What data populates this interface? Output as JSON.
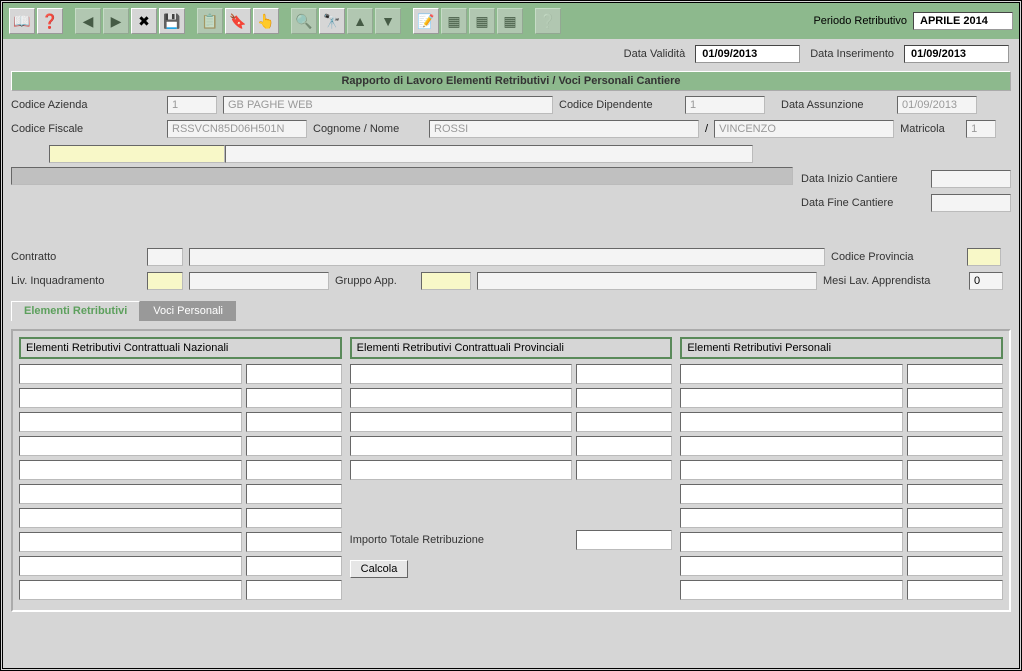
{
  "toolbar": {
    "period_label": "Periodo Retributivo",
    "period_value": "APRILE 2014",
    "icons": [
      "help",
      "hint",
      "back",
      "fwd",
      "close",
      "save",
      "log",
      "tag",
      "hand",
      "search",
      "binoc",
      "up",
      "down",
      "note",
      "grid1",
      "grid2",
      "grid3",
      "about"
    ]
  },
  "topdates": {
    "validita_label": "Data Validità",
    "validita_value": "01/09/2013",
    "inserimento_label": "Data Inserimento",
    "inserimento_value": "01/09/2013"
  },
  "section_title": "Rapporto di Lavoro Elementi Retributivi / Voci Personali Cantiere",
  "head": {
    "codice_azienda_label": "Codice Azienda",
    "codice_azienda_code": "1",
    "codice_azienda_name": "GB PAGHE WEB",
    "codice_dipendente_label": "Codice Dipendente",
    "codice_dipendente_value": "1",
    "data_assunzione_label": "Data Assunzione",
    "data_assunzione_value": "01/09/2013",
    "codice_fiscale_label": "Codice Fiscale",
    "codice_fiscale_value": "RSSVCN85D06H501N",
    "cognome_nome_label": "Cognome / Nome",
    "cognome_value": "ROSSI",
    "nome_value": "VINCENZO",
    "matricola_label": "Matricola",
    "matricola_value": "1"
  },
  "cantiere": {
    "inizio_label": "Data Inizio Cantiere",
    "fine_label": "Data Fine Cantiere"
  },
  "contract": {
    "contratto_label": "Contratto",
    "liv_label": "Liv. Inquadramento",
    "gruppo_label": "Gruppo App.",
    "provincia_label": "Codice Provincia",
    "mesi_label": "Mesi Lav. Apprendista",
    "mesi_value": "0"
  },
  "tabs": {
    "t1": "Elementi Retributivi",
    "t2": "Voci Personali"
  },
  "columns": {
    "nazionali": "Elementi Retributivi Contrattuali Nazionali",
    "provinciali": "Elementi Retributivi Contrattuali Provinciali",
    "personali": "Elementi Retributivi Personali"
  },
  "importo_label": "Importo Totale Retribuzione",
  "calcola_label": "Calcola"
}
